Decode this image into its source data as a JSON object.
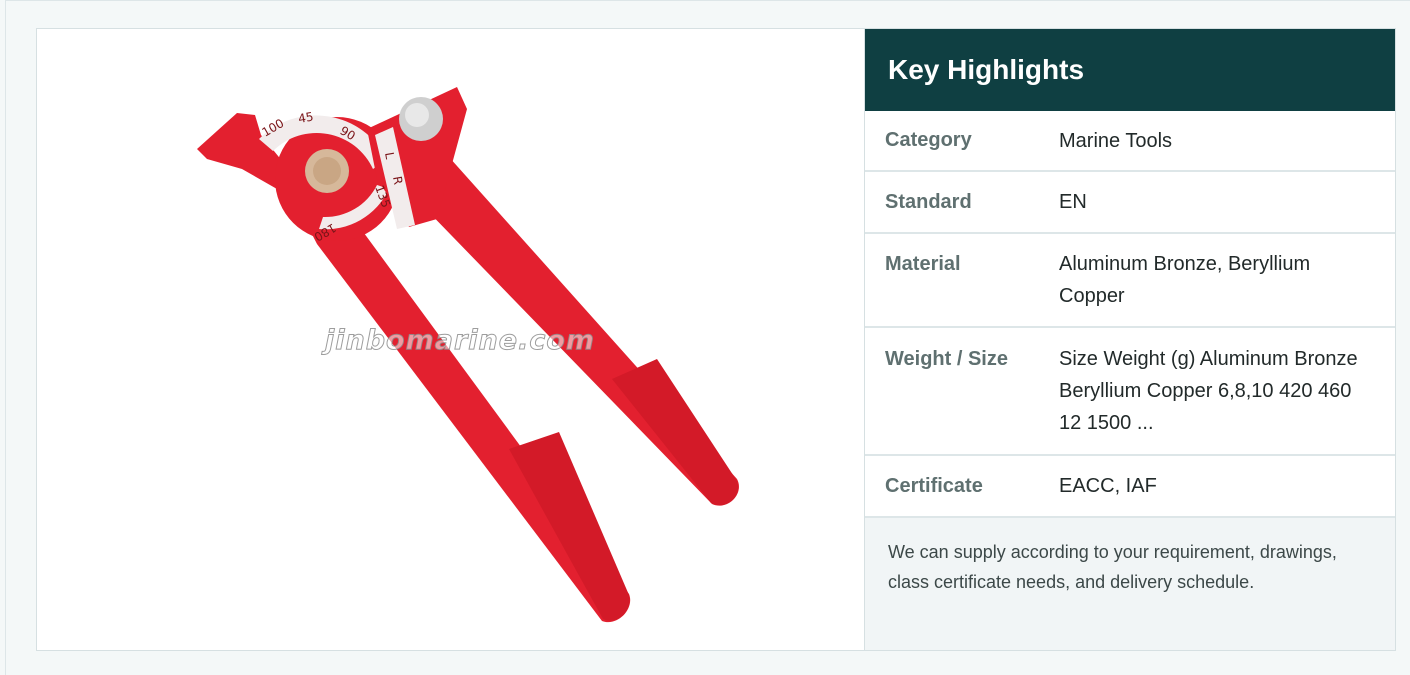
{
  "product_image": {
    "watermark": "jinbomarine.com",
    "dial_marks": [
      "100",
      "45",
      "90",
      "135",
      "180",
      "L",
      "R"
    ],
    "colors": {
      "tool_red": "#e0202f",
      "dial_white": "#f2ecec"
    }
  },
  "highlights": {
    "title": "Key Highlights",
    "rows": [
      {
        "label": "Category",
        "value": "Marine Tools"
      },
      {
        "label": "Standard",
        "value": "EN"
      },
      {
        "label": "Material",
        "value": "Aluminum Bronze, Beryllium Copper"
      },
      {
        "label": "Weight / Size",
        "value": "Size Weight (g) Aluminum Bronze Beryllium Copper 6,8,10 420 460 12 1500 ..."
      },
      {
        "label": "Certificate",
        "value": "EACC, IAF"
      }
    ],
    "note": "We can supply according to your requirement, drawings, class certificate needs, and delivery schedule.",
    "colors": {
      "header_bg": "#0f3f42",
      "label": "#5f7070",
      "note_bg": "#f1f5f6"
    }
  }
}
